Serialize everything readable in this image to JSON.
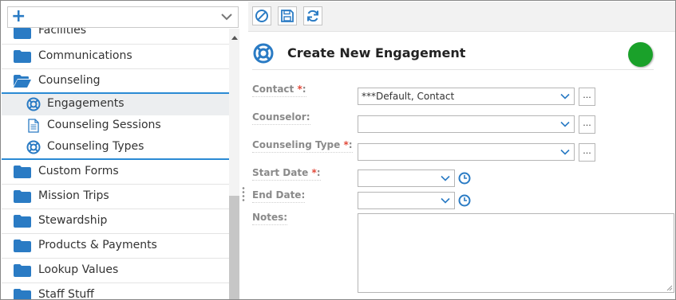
{
  "colors": {
    "accent": "#2a8ad4",
    "folder": "#2a7bc4",
    "status": "#1aa12a",
    "required": "#e24a3b"
  },
  "sidebar": {
    "add_icon": "plus-icon",
    "items": [
      {
        "label": "Facilities",
        "icon": "folder-icon"
      },
      {
        "label": "Communications",
        "icon": "folder-icon"
      },
      {
        "label": "Counseling",
        "icon": "folder-open-icon"
      },
      {
        "label": "Custom Forms",
        "icon": "folder-icon"
      },
      {
        "label": "Mission Trips",
        "icon": "folder-icon"
      },
      {
        "label": "Stewardship",
        "icon": "folder-icon"
      },
      {
        "label": "Products & Payments",
        "icon": "folder-icon"
      },
      {
        "label": "Lookup Values",
        "icon": "folder-icon"
      },
      {
        "label": "Staff Stuff",
        "icon": "folder-icon"
      }
    ],
    "sub_items": [
      {
        "label": "Engagements",
        "icon": "lifebuoy-icon",
        "selected": true
      },
      {
        "label": "Counseling Sessions",
        "icon": "document-icon",
        "selected": false
      },
      {
        "label": "Counseling Types",
        "icon": "lifebuoy-icon",
        "selected": false
      }
    ]
  },
  "toolbar": {
    "buttons": [
      {
        "icon": "cancel-icon"
      },
      {
        "icon": "save-icon"
      },
      {
        "icon": "refresh-icon"
      }
    ]
  },
  "form": {
    "title": "Create New Engagement",
    "title_icon": "lifebuoy-icon",
    "required_mark": "*",
    "fields": {
      "contact": {
        "label": "Contact",
        "suffix": ":",
        "value": "***Default, Contact",
        "lookup": "..."
      },
      "counselor": {
        "label": "Counselor:",
        "value": "",
        "lookup": "..."
      },
      "counseling_type": {
        "label": "Counseling Type",
        "suffix": ":",
        "value": "",
        "lookup": "..."
      },
      "start_date": {
        "label": "Start Date",
        "suffix": ":",
        "value": ""
      },
      "end_date": {
        "label": "End Date:",
        "value": ""
      },
      "notes": {
        "label": "Notes:",
        "value": ""
      }
    }
  }
}
